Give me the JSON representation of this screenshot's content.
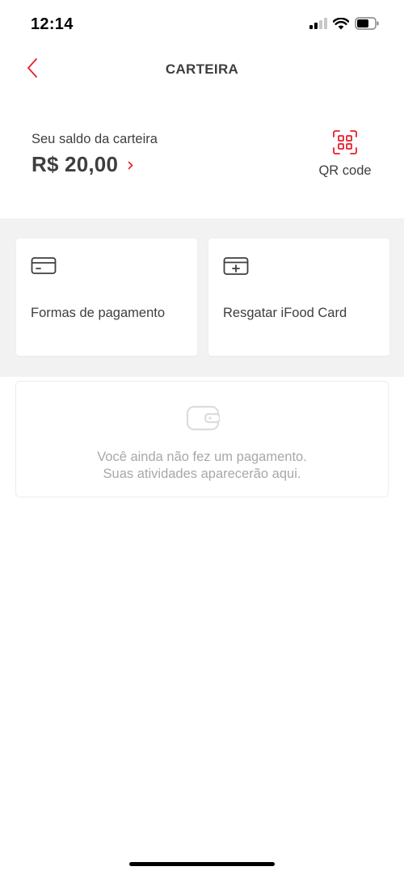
{
  "status": {
    "time": "12:14"
  },
  "header": {
    "title": "CARTEIRA"
  },
  "balance": {
    "label": "Seu saldo da carteira",
    "value": "R$ 20,00"
  },
  "qr": {
    "label": "QR code"
  },
  "actions": [
    {
      "label": "Formas de pagamento",
      "icon": "credit-card-icon"
    },
    {
      "label": "Resgatar iFood Card",
      "icon": "card-add-icon"
    }
  ],
  "activity": {
    "empty_line1": "Você ainda não fez um pagamento.",
    "empty_line2": "Suas atividades aparecerão aqui.",
    "icon": "wallet-icon"
  },
  "colors": {
    "accent": "#ea1d2c",
    "text": "#3f3e3e",
    "muted": "#a8a8a8",
    "section_bg": "#f2f2f2"
  }
}
